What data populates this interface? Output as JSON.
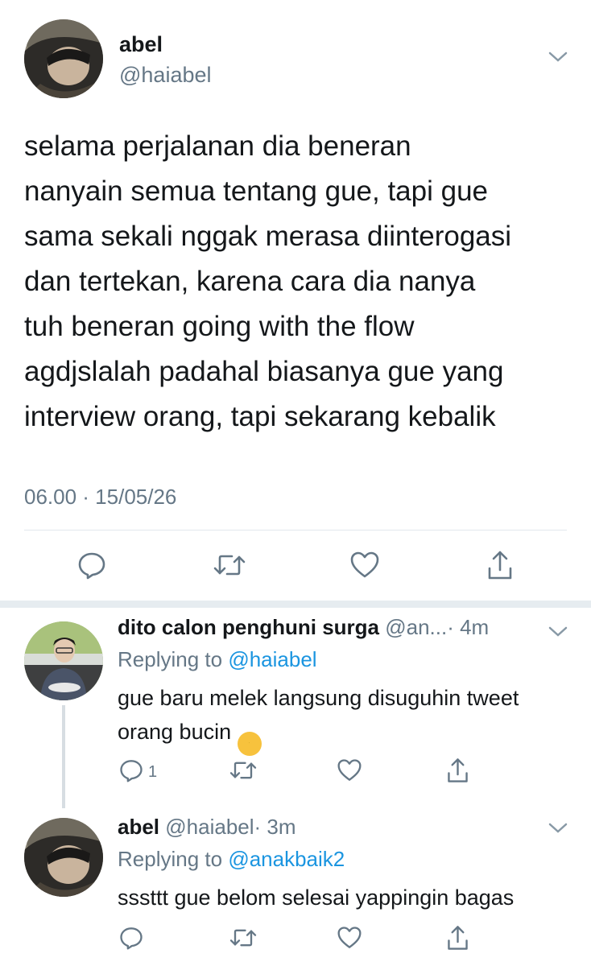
{
  "main_tweet": {
    "name": "abel",
    "handle": "@haiabel",
    "text_lines": [
      "selama perjalanan dia beneran",
      "nanyain semua tentang gue, tapi gue",
      "sama sekali nggak merasa diinterogasi",
      "dan tertekan, karena cara dia nanya",
      "tuh beneran going with the flow",
      "agdjslalah padahal biasanya gue yang",
      "interview orang, tapi sekarang kebalik"
    ],
    "timestamp": "06.00 · 15/05/26"
  },
  "replies": [
    {
      "name": "dito calon penghuni surga",
      "handle": "@an...",
      "time": "· 4m",
      "replying_prefix": "Replying to ",
      "replying_to": "@haiabel",
      "text_lines": [
        "gue baru melek langsung disuguhin tweet",
        "orang bucin"
      ],
      "emoji": "🥱",
      "reply_count": "1"
    },
    {
      "name": "abel",
      "handle": "@haiabel",
      "time": "· 3m",
      "replying_prefix": "Replying to ",
      "replying_to": "@anakbaik2",
      "text_lines": [
        "sssttt gue belom selesai yappingin bagas"
      ]
    }
  ],
  "icons": [
    "reply-icon",
    "retweet-icon",
    "like-icon",
    "share-icon",
    "chevron-down-icon"
  ],
  "colors": {
    "text": "#14171a",
    "secondary": "#657786",
    "link": "#1b95e0",
    "divider": "#e1e8ed"
  }
}
